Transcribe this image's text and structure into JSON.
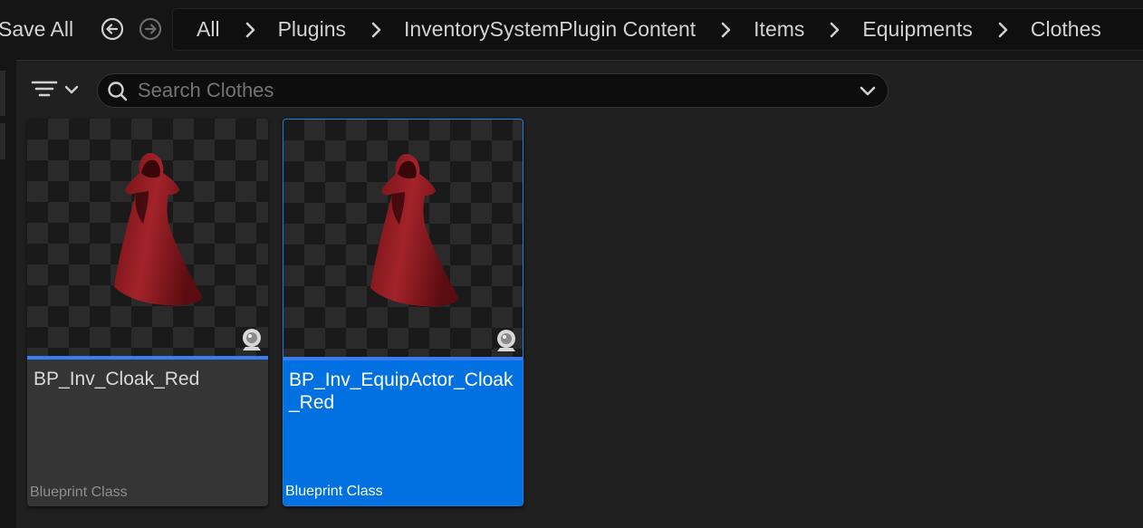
{
  "toolbar": {
    "save_all_label": "Save All"
  },
  "breadcrumb": {
    "items": [
      "All",
      "Plugins",
      "InventorySystemPlugin Content",
      "Items",
      "Equipments",
      "Clothes"
    ]
  },
  "search": {
    "value": "",
    "placeholder": "Search Clothes"
  },
  "assets": [
    {
      "name": "BP_Inv_Cloak_Red",
      "type": "Blueprint Class",
      "selected": false
    },
    {
      "name": "BP_Inv_EquipActor_Cloak_Red",
      "type": "Blueprint Class",
      "selected": true
    }
  ],
  "colors": {
    "selection": "#0170e0",
    "asset_type_bar": "#3a7df0",
    "cloak": "#8e1a1f"
  },
  "icons": {
    "back": "circle-arrow-left-icon",
    "forward": "circle-arrow-right-icon",
    "filter": "filter-icon",
    "search": "search-icon",
    "dropdown": "chevron-down-icon",
    "thumbnail_overlay": "camera-icon"
  }
}
